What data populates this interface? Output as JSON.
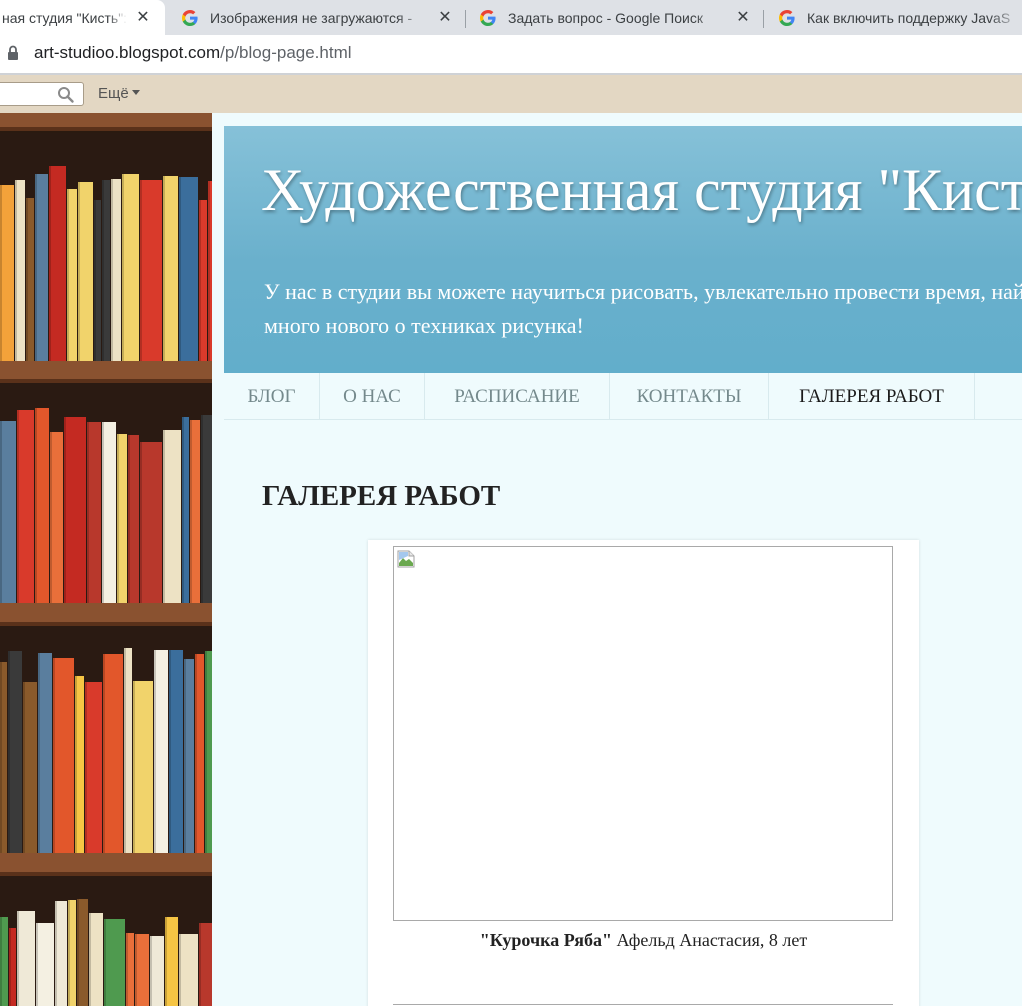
{
  "browser": {
    "tabs": [
      {
        "title": "ная студия \"Кисть\":",
        "active": true
      },
      {
        "title": "Изображения не загружаются -",
        "active": false
      },
      {
        "title": "Задать вопрос - Google Поиск",
        "active": false
      },
      {
        "title": "Как включить поддержку JavaS",
        "active": false
      }
    ],
    "url_host": "art-studioo.blogspot.com",
    "url_path": "/p/blog-page.html"
  },
  "navbar": {
    "more_label": "Ещё"
  },
  "header": {
    "title": "Художественная студия \"Кисть\"",
    "description": "У нас в студии вы можете научиться рисовать, увлекательно провести время, найти новых друзей и узнать много нового о техниках рисунка!"
  },
  "tabs": [
    {
      "label": "БЛОГ",
      "active": false
    },
    {
      "label": "О НАС",
      "active": false
    },
    {
      "label": "РАСПИСАНИЕ",
      "active": false
    },
    {
      "label": "КОНТАКТЫ",
      "active": false
    },
    {
      "label": "ГАЛЕРЕЯ РАБОТ",
      "active": true
    }
  ],
  "post": {
    "title": "ГАЛЕРЕЯ РАБОТ",
    "caption_title": "\"Курочка Ряба\"",
    "caption_author": " Афельд Анастасия, 8 лет"
  },
  "colors": {
    "header_bg": "#6ab0cc",
    "page_bg": "#effbfd",
    "navbar_bg": "#e3d7c3"
  }
}
